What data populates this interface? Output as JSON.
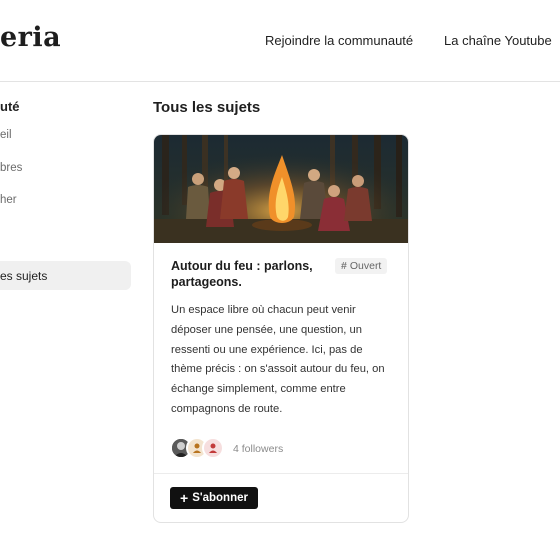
{
  "header": {
    "logo_text": "eria",
    "nav": [
      {
        "label": "Rejoindre la communauté"
      },
      {
        "label": "La chaîne Youtube"
      }
    ]
  },
  "sidebar": {
    "heading": "uté",
    "items": [
      {
        "label": "eil"
      },
      {
        "label": "bres"
      },
      {
        "label": "her"
      },
      {
        "label": "es sujets"
      }
    ]
  },
  "main": {
    "title": "Tous les sujets",
    "card": {
      "image_icon": "campfire-illustration",
      "title": "Autour du feu : parlons, partageons.",
      "badge": "Ouvert",
      "description": "Un espace libre où chacun peut venir déposer une pensée, une question, un ressenti ou une expérience. Ici, pas de thème précis : on s'assoit autour du feu, on échange simplement, comme entre compagnons de route.",
      "followers": "4 followers",
      "subscribe_label": "S'abonner"
    }
  },
  "colors": {
    "accent": "#c02a2a",
    "button_bg": "#111111",
    "active_bg": "#f0f0f0"
  }
}
